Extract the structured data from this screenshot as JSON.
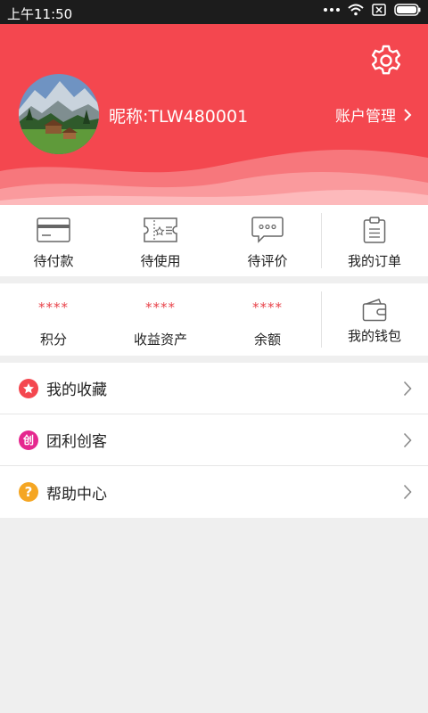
{
  "status_bar": {
    "time": "上午11:50"
  },
  "header": {
    "nickname": "昵称:TLW480001",
    "account_label": "账户管理"
  },
  "orders": {
    "items": [
      {
        "label": "待付款",
        "icon": "card-icon"
      },
      {
        "label": "待使用",
        "icon": "ticket-icon"
      },
      {
        "label": "待评价",
        "icon": "comment-icon"
      },
      {
        "label": "我的订单",
        "icon": "clipboard-icon"
      }
    ]
  },
  "assets": {
    "items": [
      {
        "value": "****",
        "label": "积分"
      },
      {
        "value": "****",
        "label": "收益资产"
      },
      {
        "value": "****",
        "label": "余额"
      }
    ],
    "wallet_label": "我的钱包"
  },
  "menu": {
    "items": [
      {
        "label": "我的收藏",
        "icon_color": "#f4474f",
        "icon": "star-icon"
      },
      {
        "label": "团利创客",
        "icon_color": "#e5288f",
        "icon": "chuang-icon",
        "glyph": "创"
      },
      {
        "label": "帮助中心",
        "icon_color": "#f5a623",
        "icon": "help-icon",
        "glyph": "?"
      }
    ]
  },
  "colors": {
    "accent": "#f4474f",
    "star_value": "#e8434a"
  }
}
